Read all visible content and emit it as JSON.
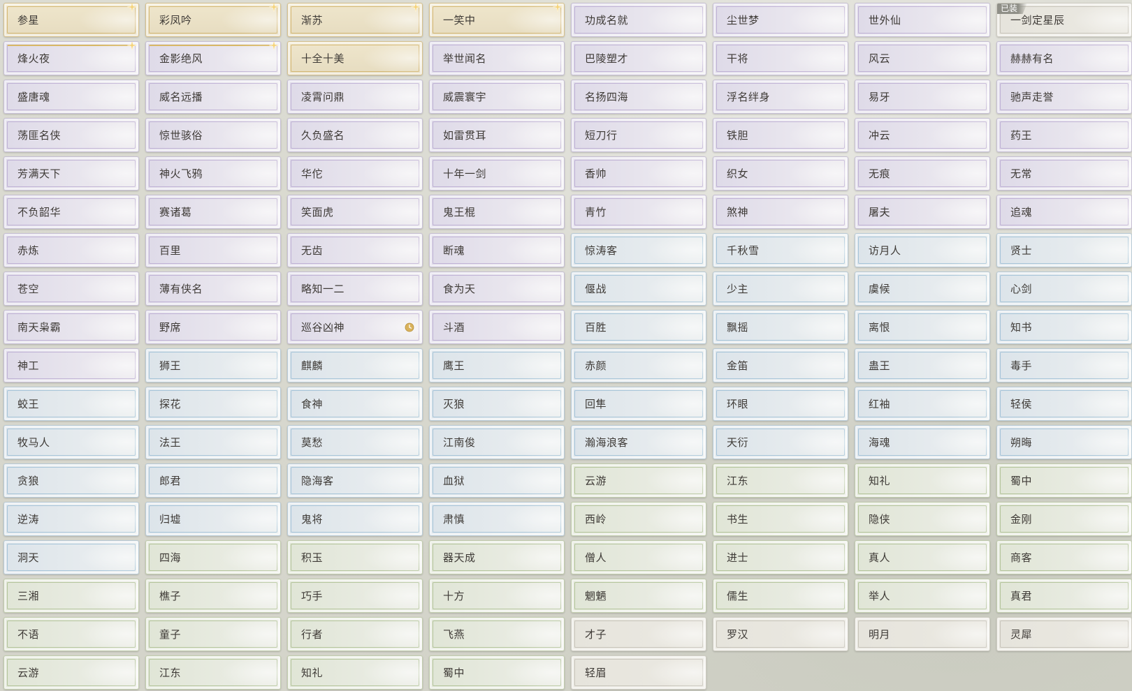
{
  "icons": {
    "star": "star-icon",
    "clock": "clock-icon"
  },
  "colors": {
    "gold": "#d8b765",
    "purple": "#b7a6d6",
    "blue": "#8fbbd9",
    "green": "#a8bd86",
    "text": "#3e3a36",
    "badge": "#8f8f87"
  },
  "titles": [
    {
      "label": "参星",
      "rarity": "gold",
      "star": true
    },
    {
      "label": "彩凤吟",
      "rarity": "gold",
      "star": true
    },
    {
      "label": "渐苏",
      "rarity": "gold",
      "star": true
    },
    {
      "label": "一笑中",
      "rarity": "gold",
      "star": true
    },
    {
      "label": "功成名就",
      "rarity": "purple"
    },
    {
      "label": "尘世梦",
      "rarity": "purple"
    },
    {
      "label": "世外仙",
      "rarity": "purple"
    },
    {
      "label": "一剑定星辰",
      "rarity": "plain",
      "badge": "已装"
    },
    {
      "label": "烽火夜",
      "rarity": "purple",
      "star": true,
      "accent": true
    },
    {
      "label": "金影绝风",
      "rarity": "purple",
      "star": true,
      "accent": true
    },
    {
      "label": "十全十美",
      "rarity": "gold"
    },
    {
      "label": "举世闻名",
      "rarity": "purple"
    },
    {
      "label": "巴陵塑才",
      "rarity": "purple"
    },
    {
      "label": "干将",
      "rarity": "purple"
    },
    {
      "label": "风云",
      "rarity": "purple"
    },
    {
      "label": "赫赫有名",
      "rarity": "purple"
    },
    {
      "label": "盛唐魂",
      "rarity": "purple"
    },
    {
      "label": "威名远播",
      "rarity": "purple"
    },
    {
      "label": "凌霄问鼎",
      "rarity": "purple"
    },
    {
      "label": "威震寰宇",
      "rarity": "purple"
    },
    {
      "label": "名扬四海",
      "rarity": "purple"
    },
    {
      "label": "浮名绊身",
      "rarity": "purple"
    },
    {
      "label": "易牙",
      "rarity": "purple"
    },
    {
      "label": "驰声走誉",
      "rarity": "purple"
    },
    {
      "label": "荡匪名侠",
      "rarity": "purple"
    },
    {
      "label": "惊世骇俗",
      "rarity": "purple"
    },
    {
      "label": "久负盛名",
      "rarity": "purple"
    },
    {
      "label": "如雷贯耳",
      "rarity": "purple"
    },
    {
      "label": "短刀行",
      "rarity": "purple"
    },
    {
      "label": "铁胆",
      "rarity": "purple"
    },
    {
      "label": "冲云",
      "rarity": "purple"
    },
    {
      "label": "药王",
      "rarity": "purple"
    },
    {
      "label": "芳满天下",
      "rarity": "purple"
    },
    {
      "label": "神火飞鸦",
      "rarity": "purple"
    },
    {
      "label": "华佗",
      "rarity": "purple"
    },
    {
      "label": "十年一剑",
      "rarity": "purple"
    },
    {
      "label": "香帅",
      "rarity": "purple"
    },
    {
      "label": "织女",
      "rarity": "purple"
    },
    {
      "label": "无痕",
      "rarity": "purple"
    },
    {
      "label": "无常",
      "rarity": "purple"
    },
    {
      "label": "不负韶华",
      "rarity": "purple"
    },
    {
      "label": "赛诸葛",
      "rarity": "purple"
    },
    {
      "label": "笑面虎",
      "rarity": "purple"
    },
    {
      "label": "鬼王棍",
      "rarity": "purple"
    },
    {
      "label": "青竹",
      "rarity": "purple"
    },
    {
      "label": "煞神",
      "rarity": "purple"
    },
    {
      "label": "屠夫",
      "rarity": "purple"
    },
    {
      "label": "追魂",
      "rarity": "purple"
    },
    {
      "label": "赤炼",
      "rarity": "purple"
    },
    {
      "label": "百里",
      "rarity": "purple"
    },
    {
      "label": "无齿",
      "rarity": "purple"
    },
    {
      "label": "断魂",
      "rarity": "purple"
    },
    {
      "label": "惊涛客",
      "rarity": "blue"
    },
    {
      "label": "千秋雪",
      "rarity": "blue"
    },
    {
      "label": "访月人",
      "rarity": "blue"
    },
    {
      "label": "贤士",
      "rarity": "blue"
    },
    {
      "label": "苍空",
      "rarity": "purple"
    },
    {
      "label": "薄有侠名",
      "rarity": "purple"
    },
    {
      "label": "略知一二",
      "rarity": "purple"
    },
    {
      "label": "食为天",
      "rarity": "purple"
    },
    {
      "label": "偃战",
      "rarity": "blue"
    },
    {
      "label": "少主",
      "rarity": "blue"
    },
    {
      "label": "虞候",
      "rarity": "blue"
    },
    {
      "label": "心剑",
      "rarity": "blue"
    },
    {
      "label": "南天枭霸",
      "rarity": "purple"
    },
    {
      "label": "野席",
      "rarity": "purple"
    },
    {
      "label": "巡谷凶神",
      "rarity": "purple",
      "clock": true
    },
    {
      "label": "斗酒",
      "rarity": "purple"
    },
    {
      "label": "百胜",
      "rarity": "blue"
    },
    {
      "label": "飘摇",
      "rarity": "blue"
    },
    {
      "label": "离恨",
      "rarity": "blue"
    },
    {
      "label": "知书",
      "rarity": "blue"
    },
    {
      "label": "神工",
      "rarity": "purple"
    },
    {
      "label": "狮王",
      "rarity": "blue"
    },
    {
      "label": "麒麟",
      "rarity": "blue"
    },
    {
      "label": "鹰王",
      "rarity": "blue"
    },
    {
      "label": "赤颜",
      "rarity": "blue"
    },
    {
      "label": "金笛",
      "rarity": "blue"
    },
    {
      "label": "蛊王",
      "rarity": "blue"
    },
    {
      "label": "毒手",
      "rarity": "blue"
    },
    {
      "label": "蛟王",
      "rarity": "blue"
    },
    {
      "label": "探花",
      "rarity": "blue"
    },
    {
      "label": "食神",
      "rarity": "blue"
    },
    {
      "label": "灭狼",
      "rarity": "blue"
    },
    {
      "label": "回隼",
      "rarity": "blue"
    },
    {
      "label": "环眼",
      "rarity": "blue"
    },
    {
      "label": "红袖",
      "rarity": "blue"
    },
    {
      "label": "轻侯",
      "rarity": "blue"
    },
    {
      "label": "牧马人",
      "rarity": "blue"
    },
    {
      "label": "法王",
      "rarity": "blue"
    },
    {
      "label": "莫愁",
      "rarity": "blue"
    },
    {
      "label": "江南俊",
      "rarity": "blue"
    },
    {
      "label": "瀚海浪客",
      "rarity": "blue"
    },
    {
      "label": "天衍",
      "rarity": "blue"
    },
    {
      "label": "海魂",
      "rarity": "blue"
    },
    {
      "label": "朔晦",
      "rarity": "blue"
    },
    {
      "label": "贪狼",
      "rarity": "blue"
    },
    {
      "label": "郎君",
      "rarity": "blue"
    },
    {
      "label": "隐海客",
      "rarity": "blue"
    },
    {
      "label": "血狱",
      "rarity": "blue"
    },
    {
      "label": "云游",
      "rarity": "green"
    },
    {
      "label": "江东",
      "rarity": "green"
    },
    {
      "label": "知礼",
      "rarity": "green"
    },
    {
      "label": "蜀中",
      "rarity": "green"
    },
    {
      "label": "逆涛",
      "rarity": "blue"
    },
    {
      "label": "归墟",
      "rarity": "blue"
    },
    {
      "label": "鬼将",
      "rarity": "blue"
    },
    {
      "label": "肃慎",
      "rarity": "blue"
    },
    {
      "label": "西岭",
      "rarity": "green"
    },
    {
      "label": "书生",
      "rarity": "green"
    },
    {
      "label": "隐侠",
      "rarity": "green"
    },
    {
      "label": "金刚",
      "rarity": "green"
    },
    {
      "label": "洞天",
      "rarity": "blue"
    },
    {
      "label": "四海",
      "rarity": "green"
    },
    {
      "label": "积玉",
      "rarity": "green"
    },
    {
      "label": "器天成",
      "rarity": "green"
    },
    {
      "label": "僧人",
      "rarity": "green"
    },
    {
      "label": "进士",
      "rarity": "green"
    },
    {
      "label": "真人",
      "rarity": "green"
    },
    {
      "label": "商客",
      "rarity": "green"
    },
    {
      "label": "三湘",
      "rarity": "green"
    },
    {
      "label": "樵子",
      "rarity": "green"
    },
    {
      "label": "巧手",
      "rarity": "green"
    },
    {
      "label": "十方",
      "rarity": "green"
    },
    {
      "label": "魍魉",
      "rarity": "green"
    },
    {
      "label": "儒生",
      "rarity": "green"
    },
    {
      "label": "举人",
      "rarity": "green"
    },
    {
      "label": "真君",
      "rarity": "green"
    },
    {
      "label": "不语",
      "rarity": "green"
    },
    {
      "label": "童子",
      "rarity": "green"
    },
    {
      "label": "行者",
      "rarity": "green"
    },
    {
      "label": "飞燕",
      "rarity": "green"
    },
    {
      "label": "才子",
      "rarity": "plain"
    },
    {
      "label": "罗汉",
      "rarity": "plain"
    },
    {
      "label": "明月",
      "rarity": "plain"
    },
    {
      "label": "灵犀",
      "rarity": "plain"
    },
    {
      "label": "云游",
      "rarity": "green"
    },
    {
      "label": "江东",
      "rarity": "green"
    },
    {
      "label": "知礼",
      "rarity": "green"
    },
    {
      "label": "蜀中",
      "rarity": "green"
    },
    {
      "label": "轻眉",
      "rarity": "plain"
    }
  ]
}
